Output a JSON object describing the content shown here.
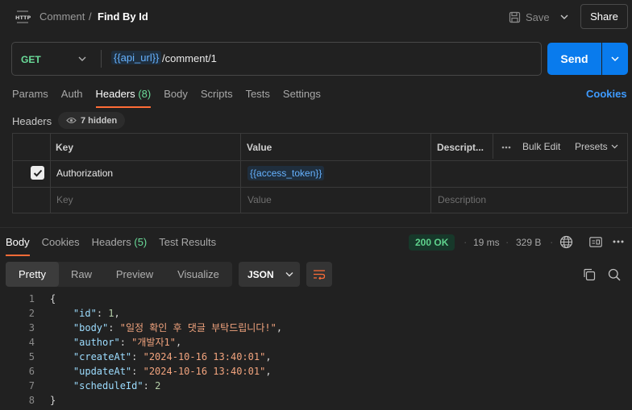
{
  "header": {
    "icon_text": "HTTP",
    "breadcrumb_parent": "Comment",
    "breadcrumb_sep": "/",
    "title": "Find By Id",
    "save_label": "Save",
    "share_label": "Share"
  },
  "request": {
    "method": "GET",
    "url_variable": "{{api_url}}",
    "url_path": "/comment/1",
    "send_label": "Send"
  },
  "request_tabs": [
    {
      "label": "Params",
      "count": ""
    },
    {
      "label": "Auth",
      "count": ""
    },
    {
      "label": "Headers",
      "count": "(8)"
    },
    {
      "label": "Body",
      "count": ""
    },
    {
      "label": "Scripts",
      "count": ""
    },
    {
      "label": "Tests",
      "count": ""
    },
    {
      "label": "Settings",
      "count": ""
    }
  ],
  "cookies_label": "Cookies",
  "headers_section": {
    "label": "Headers",
    "hidden_label": "7 hidden"
  },
  "headers_table": {
    "columns": {
      "key": "Key",
      "value": "Value",
      "description": "Descript..."
    },
    "bulk_edit": "Bulk Edit",
    "presets": "Presets",
    "rows": [
      {
        "key": "Authorization",
        "value": "{{access_token}}",
        "description": "",
        "checked": true
      }
    ],
    "placeholder": {
      "key": "Key",
      "value": "Value",
      "description": "Description"
    }
  },
  "response_tabs": [
    {
      "label": "Body",
      "count": ""
    },
    {
      "label": "Cookies",
      "count": ""
    },
    {
      "label": "Headers",
      "count": "(5)"
    },
    {
      "label": "Test Results",
      "count": ""
    }
  ],
  "response_meta": {
    "status": "200 OK",
    "time": "19 ms",
    "size": "329 B",
    "status_color": "#5fd38d"
  },
  "view_modes": [
    "Pretty",
    "Raw",
    "Preview",
    "Visualize"
  ],
  "format": "JSON",
  "code_lines": [
    {
      "n": "1",
      "parts": [
        {
          "c": "p",
          "t": "{"
        }
      ]
    },
    {
      "n": "2",
      "parts": [
        {
          "c": "p",
          "t": "    "
        },
        {
          "c": "k",
          "t": "\"id\""
        },
        {
          "c": "p",
          "t": ": "
        },
        {
          "c": "n",
          "t": "1"
        },
        {
          "c": "p",
          "t": ","
        }
      ]
    },
    {
      "n": "3",
      "parts": [
        {
          "c": "p",
          "t": "    "
        },
        {
          "c": "k",
          "t": "\"body\""
        },
        {
          "c": "p",
          "t": ": "
        },
        {
          "c": "s",
          "t": "\"일정 확인 후 댓글 부탁드립니다!\""
        },
        {
          "c": "p",
          "t": ","
        }
      ]
    },
    {
      "n": "4",
      "parts": [
        {
          "c": "p",
          "t": "    "
        },
        {
          "c": "k",
          "t": "\"author\""
        },
        {
          "c": "p",
          "t": ": "
        },
        {
          "c": "s",
          "t": "\"개발자1\""
        },
        {
          "c": "p",
          "t": ","
        }
      ]
    },
    {
      "n": "5",
      "parts": [
        {
          "c": "p",
          "t": "    "
        },
        {
          "c": "k",
          "t": "\"createAt\""
        },
        {
          "c": "p",
          "t": ": "
        },
        {
          "c": "s",
          "t": "\"2024-10-16 13:40:01\""
        },
        {
          "c": "p",
          "t": ","
        }
      ]
    },
    {
      "n": "6",
      "parts": [
        {
          "c": "p",
          "t": "    "
        },
        {
          "c": "k",
          "t": "\"updateAt\""
        },
        {
          "c": "p",
          "t": ": "
        },
        {
          "c": "s",
          "t": "\"2024-10-16 13:40:01\""
        },
        {
          "c": "p",
          "t": ","
        }
      ]
    },
    {
      "n": "7",
      "parts": [
        {
          "c": "p",
          "t": "    "
        },
        {
          "c": "k",
          "t": "\"scheduleId\""
        },
        {
          "c": "p",
          "t": ": "
        },
        {
          "c": "n",
          "t": "2"
        }
      ]
    },
    {
      "n": "8",
      "parts": [
        {
          "c": "p",
          "t": "}"
        }
      ]
    }
  ],
  "colors": {
    "accent_tab": "#ff6c37",
    "send_button": "#097bed",
    "link": "#3e9bff",
    "method_get": "#6bdd9a"
  }
}
